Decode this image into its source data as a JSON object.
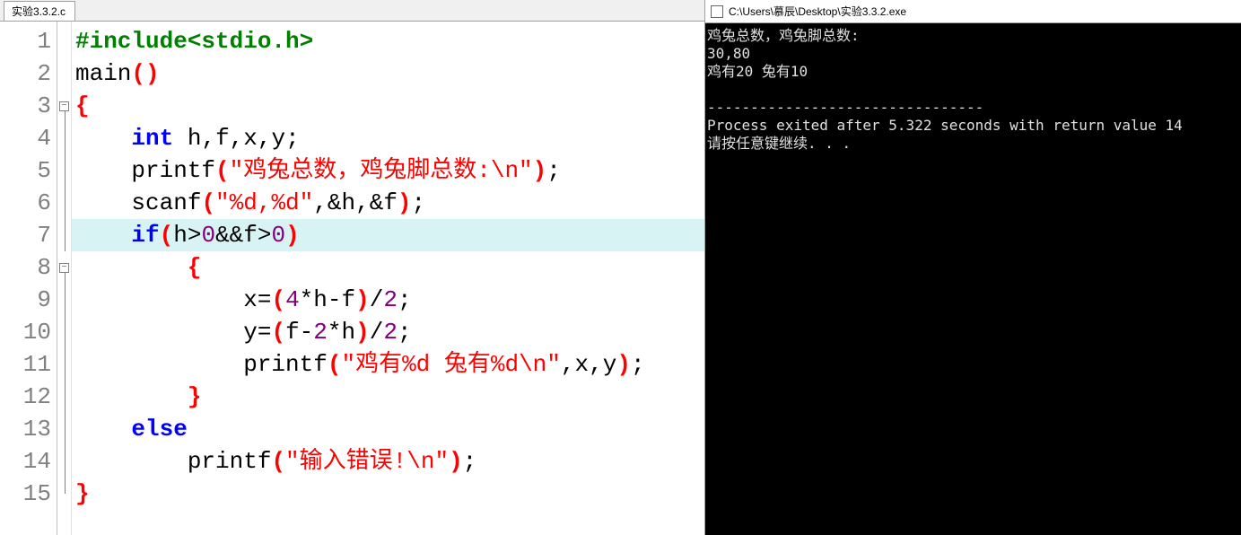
{
  "editor": {
    "tab_label": "实验3.3.2.c",
    "highlighted_line": 7,
    "lines": [
      {
        "num": 1,
        "fold": "",
        "tokens": [
          {
            "c": "pp",
            "t": "#include<stdio.h>"
          }
        ]
      },
      {
        "num": 2,
        "fold": "",
        "tokens": [
          {
            "c": "fn",
            "t": "main"
          },
          {
            "c": "br",
            "t": "()"
          }
        ]
      },
      {
        "num": 3,
        "fold": "box",
        "tokens": [
          {
            "c": "br",
            "t": "{"
          }
        ]
      },
      {
        "num": 4,
        "fold": "line",
        "tokens": [
          {
            "c": "id",
            "t": "    "
          },
          {
            "c": "k",
            "t": "int"
          },
          {
            "c": "id",
            "t": " h"
          },
          {
            "c": "op",
            "t": ","
          },
          {
            "c": "id",
            "t": "f"
          },
          {
            "c": "op",
            "t": ","
          },
          {
            "c": "id",
            "t": "x"
          },
          {
            "c": "op",
            "t": ","
          },
          {
            "c": "id",
            "t": "y"
          },
          {
            "c": "op",
            "t": ";"
          }
        ]
      },
      {
        "num": 5,
        "fold": "line",
        "tokens": [
          {
            "c": "id",
            "t": "    printf"
          },
          {
            "c": "br",
            "t": "("
          },
          {
            "c": "s",
            "t": "\"鸡兔总数，鸡兔脚总数:\\n\""
          },
          {
            "c": "br",
            "t": ")"
          },
          {
            "c": "op",
            "t": ";"
          }
        ]
      },
      {
        "num": 6,
        "fold": "line",
        "tokens": [
          {
            "c": "id",
            "t": "    scanf"
          },
          {
            "c": "br",
            "t": "("
          },
          {
            "c": "s",
            "t": "\"%d,%d\""
          },
          {
            "c": "op",
            "t": ","
          },
          {
            "c": "op",
            "t": "&"
          },
          {
            "c": "id",
            "t": "h"
          },
          {
            "c": "op",
            "t": ","
          },
          {
            "c": "op",
            "t": "&"
          },
          {
            "c": "id",
            "t": "f"
          },
          {
            "c": "br",
            "t": ")"
          },
          {
            "c": "op",
            "t": ";"
          }
        ]
      },
      {
        "num": 7,
        "fold": "line",
        "tokens": [
          {
            "c": "id",
            "t": "    "
          },
          {
            "c": "k",
            "t": "if"
          },
          {
            "c": "br",
            "t": "("
          },
          {
            "c": "id",
            "t": "h"
          },
          {
            "c": "op",
            "t": ">"
          },
          {
            "c": "n",
            "t": "0"
          },
          {
            "c": "op",
            "t": "&&"
          },
          {
            "c": "id",
            "t": "f"
          },
          {
            "c": "op",
            "t": ">"
          },
          {
            "c": "n",
            "t": "0"
          },
          {
            "c": "br",
            "t": ")"
          }
        ]
      },
      {
        "num": 8,
        "fold": "box",
        "tokens": [
          {
            "c": "id",
            "t": "        "
          },
          {
            "c": "br",
            "t": "{"
          }
        ]
      },
      {
        "num": 9,
        "fold": "line",
        "tokens": [
          {
            "c": "id",
            "t": "            x"
          },
          {
            "c": "op",
            "t": "="
          },
          {
            "c": "br",
            "t": "("
          },
          {
            "c": "n",
            "t": "4"
          },
          {
            "c": "op",
            "t": "*"
          },
          {
            "c": "id",
            "t": "h"
          },
          {
            "c": "op",
            "t": "-"
          },
          {
            "c": "id",
            "t": "f"
          },
          {
            "c": "br",
            "t": ")"
          },
          {
            "c": "op",
            "t": "/"
          },
          {
            "c": "n",
            "t": "2"
          },
          {
            "c": "op",
            "t": ";"
          }
        ]
      },
      {
        "num": 10,
        "fold": "line",
        "tokens": [
          {
            "c": "id",
            "t": "            y"
          },
          {
            "c": "op",
            "t": "="
          },
          {
            "c": "br",
            "t": "("
          },
          {
            "c": "id",
            "t": "f"
          },
          {
            "c": "op",
            "t": "-"
          },
          {
            "c": "n",
            "t": "2"
          },
          {
            "c": "op",
            "t": "*"
          },
          {
            "c": "id",
            "t": "h"
          },
          {
            "c": "br",
            "t": ")"
          },
          {
            "c": "op",
            "t": "/"
          },
          {
            "c": "n",
            "t": "2"
          },
          {
            "c": "op",
            "t": ";"
          }
        ]
      },
      {
        "num": 11,
        "fold": "line",
        "tokens": [
          {
            "c": "id",
            "t": "            printf"
          },
          {
            "c": "br",
            "t": "("
          },
          {
            "c": "s",
            "t": "\"鸡有%d 兔有%d\\n\""
          },
          {
            "c": "op",
            "t": ","
          },
          {
            "c": "id",
            "t": "x"
          },
          {
            "c": "op",
            "t": ","
          },
          {
            "c": "id",
            "t": "y"
          },
          {
            "c": "br",
            "t": ")"
          },
          {
            "c": "op",
            "t": ";"
          }
        ]
      },
      {
        "num": 12,
        "fold": "line",
        "tokens": [
          {
            "c": "id",
            "t": "        "
          },
          {
            "c": "br",
            "t": "}"
          }
        ]
      },
      {
        "num": 13,
        "fold": "line",
        "tokens": [
          {
            "c": "id",
            "t": "    "
          },
          {
            "c": "k",
            "t": "else"
          }
        ]
      },
      {
        "num": 14,
        "fold": "line",
        "tokens": [
          {
            "c": "id",
            "t": "        printf"
          },
          {
            "c": "br",
            "t": "("
          },
          {
            "c": "s",
            "t": "\"输入错误!\\n\""
          },
          {
            "c": "br",
            "t": ")"
          },
          {
            "c": "op",
            "t": ";"
          }
        ]
      },
      {
        "num": 15,
        "fold": "end",
        "tokens": [
          {
            "c": "br",
            "t": "}"
          }
        ]
      }
    ]
  },
  "console": {
    "title": "C:\\Users\\慕辰\\Desktop\\实验3.3.2.exe",
    "lines": [
      "鸡兔总数，鸡兔脚总数:",
      "30,80",
      "鸡有20 兔有10",
      "",
      "--------------------------------",
      "Process exited after 5.322 seconds with return value 14",
      "请按任意键继续. . ."
    ]
  }
}
